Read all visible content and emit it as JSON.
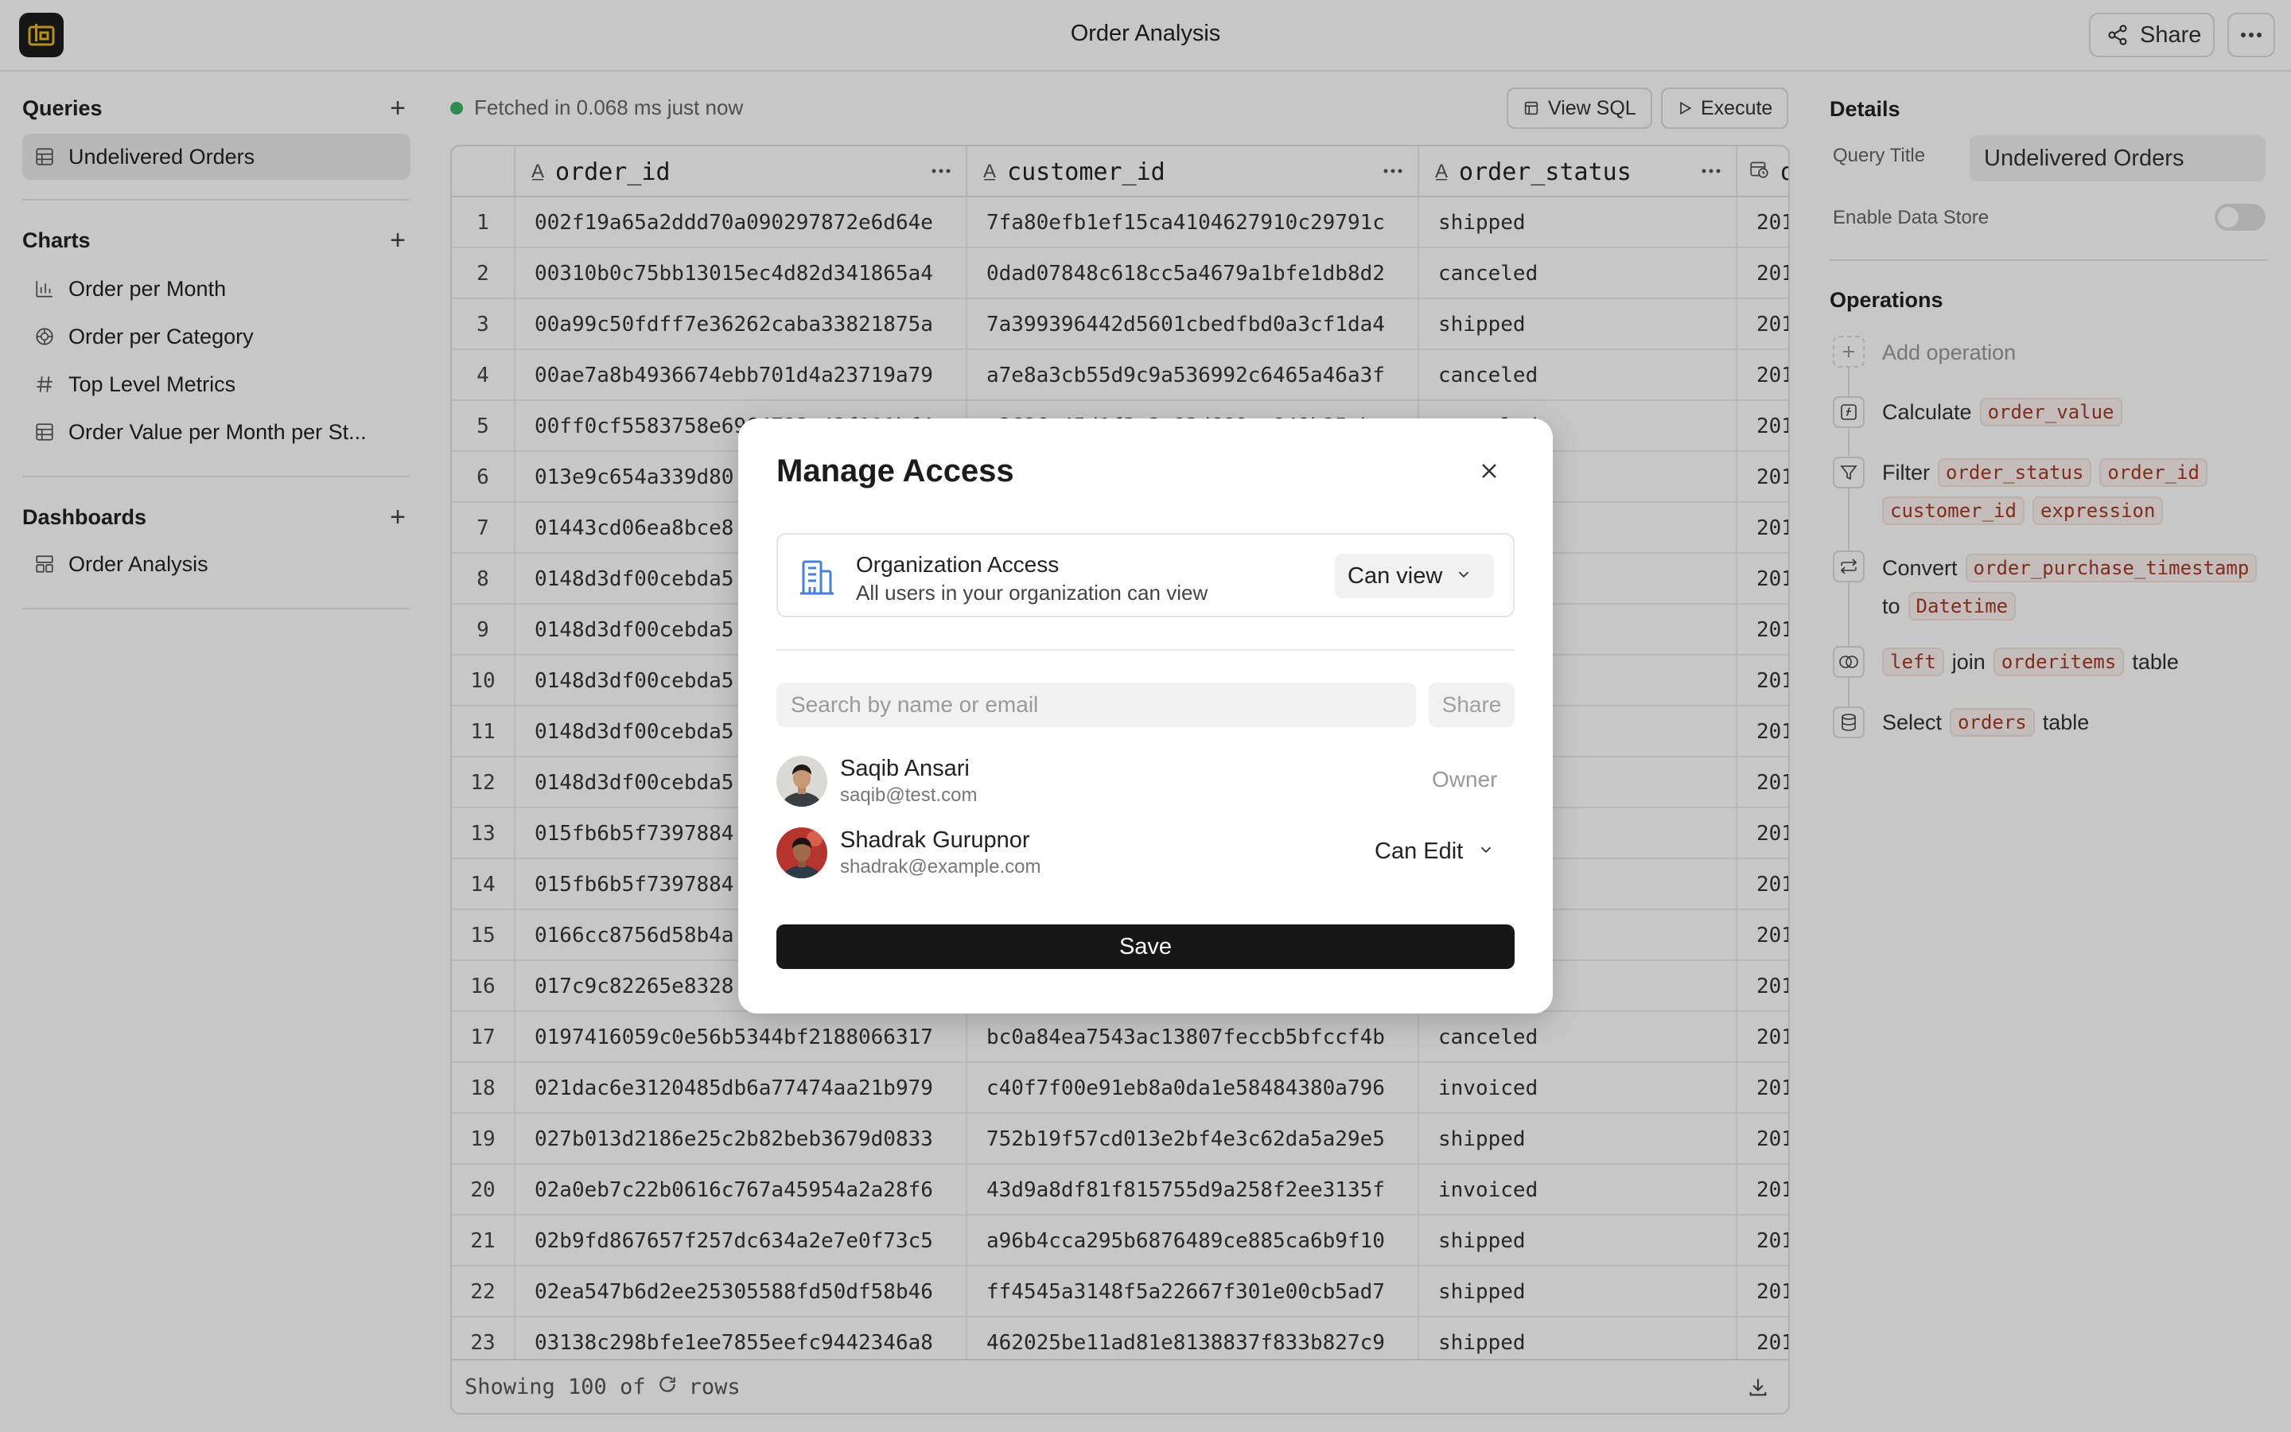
{
  "app": {
    "title": "Order Analysis",
    "share_label": "Share"
  },
  "sidebar": {
    "queries": {
      "title": "Queries",
      "items": [
        {
          "label": "Undelivered Orders",
          "icon": "table-icon"
        }
      ]
    },
    "charts": {
      "title": "Charts",
      "items": [
        {
          "label": "Order per Month",
          "icon": "bar-chart-icon"
        },
        {
          "label": "Order per Category",
          "icon": "pie-chart-icon"
        },
        {
          "label": "Top Level Metrics",
          "icon": "hash-icon"
        },
        {
          "label": "Order Value per Month per St...",
          "icon": "table-icon"
        }
      ]
    },
    "dashboards": {
      "title": "Dashboards",
      "items": [
        {
          "label": "Order Analysis",
          "icon": "dashboard-icon"
        }
      ]
    }
  },
  "main": {
    "status": "Fetched in 0.068 ms just now",
    "view_sql": "View SQL",
    "execute": "Execute",
    "columns": [
      "order_id",
      "customer_id",
      "order_status",
      "o"
    ],
    "rows": [
      [
        "1",
        "002f19a65a2ddd70a090297872e6d64e",
        "7fa80efb1ef15ca4104627910c29791c",
        "shipped",
        "201"
      ],
      [
        "2",
        "00310b0c75bb13015ec4d82d341865a4",
        "0dad07848c618cc5a4679a1bfe1db8d2",
        "canceled",
        "201"
      ],
      [
        "3",
        "00a99c50fdff7e36262caba33821875a",
        "7a399396442d5601cbedfbd0a3cf1da4",
        "shipped",
        "201"
      ],
      [
        "4",
        "00ae7a8b4936674ebb701d4a23719a79",
        "a7e8a3cb55d9c9a536992c6465a46a3f",
        "canceled",
        "201"
      ],
      [
        "5",
        "00ff0cf5583758e6964723e42f111bf4",
        "e2626e45d1f3a3e83d689ee849b25ebe",
        "canceled",
        "201"
      ],
      [
        "6",
        "013e9c654a339d80",
        "",
        "",
        "201"
      ],
      [
        "7",
        "01443cd06ea8bce8",
        "",
        "",
        "201"
      ],
      [
        "8",
        "0148d3df00cebda5",
        "",
        "",
        "201"
      ],
      [
        "9",
        "0148d3df00cebda5",
        "",
        "",
        "201"
      ],
      [
        "10",
        "0148d3df00cebda5",
        "",
        "",
        "201"
      ],
      [
        "11",
        "0148d3df00cebda5",
        "",
        "",
        "201"
      ],
      [
        "12",
        "0148d3df00cebda5",
        "",
        "",
        "201"
      ],
      [
        "13",
        "015fb6b5f7397884",
        "",
        "",
        "201"
      ],
      [
        "14",
        "015fb6b5f7397884",
        "",
        "",
        "201"
      ],
      [
        "15",
        "0166cc8756d58b4a",
        "",
        "",
        "201"
      ],
      [
        "16",
        "017c9c82265e8328",
        "",
        "",
        "201"
      ],
      [
        "17",
        "0197416059c0e56b5344bf2188066317",
        "bc0a84ea7543ac13807feccb5bfccf4b",
        "canceled",
        "201"
      ],
      [
        "18",
        "021dac6e3120485db6a77474aa21b979",
        "c40f7f00e91eb8a0da1e58484380a796",
        "invoiced",
        "201"
      ],
      [
        "19",
        "027b013d2186e25c2b82beb3679d0833",
        "752b19f57cd013e2bf4e3c62da5a29e5",
        "shipped",
        "201"
      ],
      [
        "20",
        "02a0eb7c22b0616c767a45954a2a28f6",
        "43d9a8df81f815755d9a258f2ee3135f",
        "invoiced",
        "201"
      ],
      [
        "21",
        "02b9fd867657f257dc634a2e7e0f73c5",
        "a96b4cca295b6876489ce885ca6b9f10",
        "shipped",
        "201"
      ],
      [
        "22",
        "02ea547b6d2ee25305588fd50df58b46",
        "ff4545a3148f5a22667f301e00cb5ad7",
        "shipped",
        "201"
      ],
      [
        "23",
        "03138c298bfe1ee7855eefc9442346a8",
        "462025be11ad81e8138837f833b827c9",
        "shipped",
        "201"
      ]
    ],
    "footer": {
      "prefix": "Showing 100 of",
      "suffix": "rows"
    }
  },
  "details": {
    "title": "Details",
    "query_title_label": "Query Title",
    "query_title_value": "Undelivered Orders",
    "data_store_label": "Enable Data Store",
    "operations_title": "Operations",
    "add_operation": "Add operation",
    "ops": {
      "calculate": {
        "verb": "Calculate",
        "chips": [
          "order_value"
        ]
      },
      "filter": {
        "verb": "Filter",
        "chips": [
          "order_status",
          "order_id",
          "customer_id",
          "expression"
        ]
      },
      "convert": {
        "verb": "Convert",
        "chips": [
          "order_purchase_timestamp",
          "Datetime"
        ],
        "to": "to"
      },
      "join": {
        "chips": [
          "left",
          "orderitems"
        ],
        "word": "join",
        "suffix": "table"
      },
      "select": {
        "verb": "Select",
        "chips": [
          "orders"
        ],
        "suffix": "table"
      }
    }
  },
  "modal": {
    "title": "Manage Access",
    "org_title": "Organization Access",
    "org_subtitle": "All users in your organization can view",
    "org_permission": "Can view",
    "search_placeholder": "Search by name or email",
    "share_label": "Share",
    "users": [
      {
        "name": "Saqib Ansari",
        "email": "saqib@test.com",
        "role": "Owner"
      },
      {
        "name": "Shadrak Gurupnor",
        "email": "shadrak@example.com",
        "role": "Can Edit"
      }
    ],
    "save_label": "Save"
  }
}
